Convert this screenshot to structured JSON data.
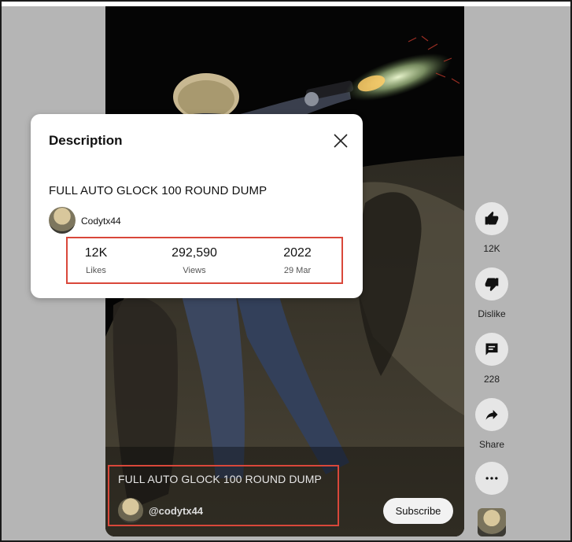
{
  "overlay": {
    "title": "FULL AUTO GLOCK 100 ROUND DUMP",
    "handle": "@codytx44",
    "subscribe_label": "Subscribe"
  },
  "actions": {
    "like_count": "12K",
    "dislike_label": "Dislike",
    "comment_count": "228",
    "share_label": "Share"
  },
  "description": {
    "heading": "Description",
    "video_title": "FULL AUTO GLOCK 100 ROUND DUMP",
    "channel_name": "Codytx44",
    "stats": [
      {
        "value": "12K",
        "caption": "Likes"
      },
      {
        "value": "292,590",
        "caption": "Views"
      },
      {
        "value": "2022",
        "caption": "29 Mar"
      }
    ]
  },
  "colors": {
    "highlight": "#d9473a",
    "page_background": "#b5b5b5",
    "action_circle": "#e6e6e6"
  }
}
